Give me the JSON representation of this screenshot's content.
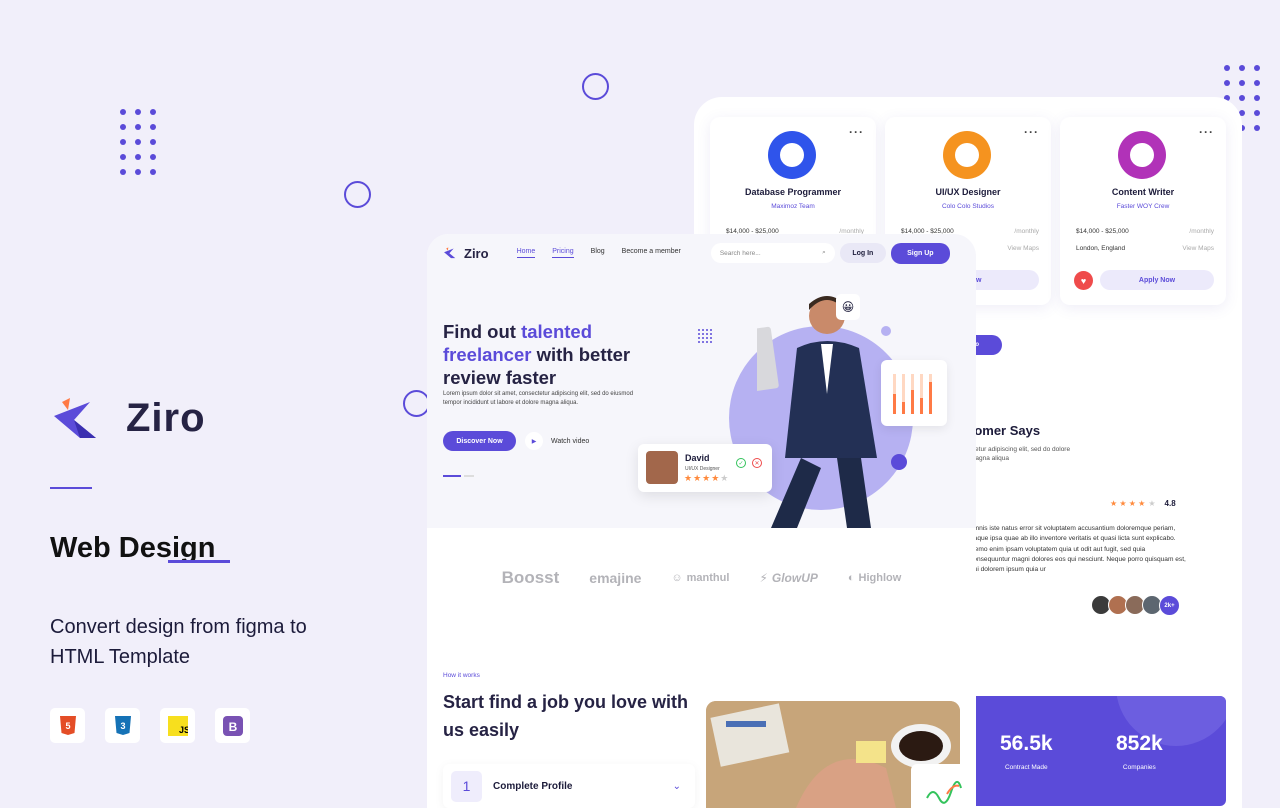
{
  "left": {
    "brand": "Ziro",
    "title": "Web Design",
    "description": "Convert design from figma to HTML Template",
    "tech": [
      "html5-icon",
      "css3-icon",
      "js-icon",
      "bootstrap-icon"
    ]
  },
  "back": {
    "jobs": [
      {
        "title": "Database Programmer",
        "company": "Maximoz Team",
        "salary": "$14,000 - $25,000",
        "period": "/monthly",
        "location": "",
        "link": "",
        "color": "#2f54eb"
      },
      {
        "title": "UI/UX Designer",
        "company": "Colo Colo Studios",
        "salary": "$14,000 - $25,000",
        "period": "/monthly",
        "location": "nd",
        "link": "View Maps",
        "apply": "ply Now",
        "color": "#f5931f"
      },
      {
        "title": "Content Writer",
        "company": "Faster WOY Crew",
        "salary": "$14,000 - $25,000",
        "period": "/monthly",
        "location": "London, England",
        "link": "View Maps",
        "apply": "Apply Now",
        "color": "#b132b8"
      }
    ],
    "pill_label": "ro",
    "testimonial": {
      "title": "tomer Says",
      "sub": "ctetur adipiscing elit, sed do dolore magna aliqua",
      "rating": "4.8",
      "body": "omnis iste natus error sit voluptatem accusantium doloremque periam, eaque ipsa quae ab illo inventore veritatis et quasi licta sunt explicabo. Nemo enim ipsam voluptatem quia ut odit aut fugit, sed quia consequuntur magni dolores eos qui nesciunt. Neque porro quisquam est, qui dolorem ipsum quia ur",
      "avatar_count": "2k+"
    },
    "stats": [
      {
        "value": "56.5k",
        "label": "Contract Made"
      },
      {
        "value": "852k",
        "label": "Companies"
      }
    ]
  },
  "front": {
    "logo": "Ziro",
    "nav": [
      "Home",
      "Pricing",
      "Blog",
      "Become a member"
    ],
    "search_placeholder": "Search here...",
    "login": "Log In",
    "signup": "Sign Up",
    "hero": {
      "line1a": "Find out ",
      "line1b": "talented",
      "line2a": "freelancer",
      "line2b": " with better",
      "line3": "review faster",
      "para": "Lorem ipsum dolor sit amet, consectetur adipiscing elit, sed do eiusmod tempor incididunt ut labore et dolore magna aliqua.",
      "discover": "Discover Now",
      "watch": "Watch video"
    },
    "profile": {
      "name": "David",
      "role": "UI/UX Designer",
      "stars": "★★★★",
      "star_off": "★"
    },
    "brands": [
      "Boosst",
      "emajine",
      "manthul",
      "GlowUP",
      "Highlow"
    ],
    "how": {
      "eyebrow": "How it works",
      "title": "Start find a job you love with us easily",
      "step_num": "1",
      "step_label": "Complete Profile"
    }
  }
}
